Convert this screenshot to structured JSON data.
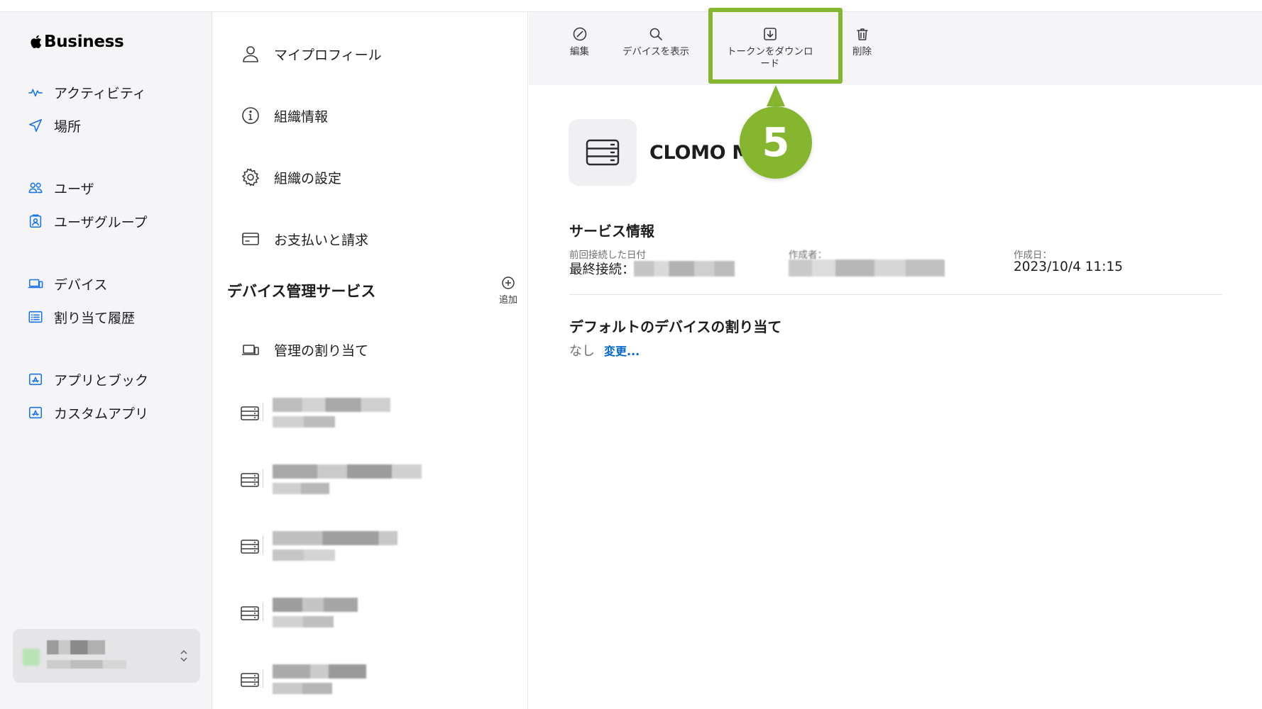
{
  "brand": {
    "name": "Business"
  },
  "sidebar": {
    "items": [
      {
        "label": "アクティビティ",
        "icon": "activity-icon"
      },
      {
        "label": "場所",
        "icon": "location-arrow-icon"
      },
      {
        "label": "ユーザ",
        "icon": "users-icon"
      },
      {
        "label": "ユーザグループ",
        "icon": "user-group-icon"
      },
      {
        "label": "デバイス",
        "icon": "devices-icon"
      },
      {
        "label": "割り当て履歴",
        "icon": "assignment-history-icon"
      },
      {
        "label": "アプリとブック",
        "icon": "app-store-icon"
      },
      {
        "label": "カスタムアプリ",
        "icon": "custom-app-icon"
      }
    ]
  },
  "settings_menu": {
    "items": [
      {
        "label": "マイプロフィール",
        "icon": "person-icon"
      },
      {
        "label": "組織情報",
        "icon": "info-icon"
      },
      {
        "label": "組織の設定",
        "icon": "gear-icon"
      },
      {
        "label": "お支払いと請求",
        "icon": "credit-card-icon"
      }
    ],
    "device_services": {
      "title": "デバイス管理サービス",
      "add_label": "追加",
      "assignment_label": "管理の割り当て"
    }
  },
  "toolbar": {
    "edit_label": "編集",
    "show_devices_label": "デバイスを表示",
    "download_token_label_line1": "トークンをダウンロ",
    "download_token_label_line2": "ード",
    "delete_label": "削除"
  },
  "callout": {
    "number": "5",
    "color": "#86b52f"
  },
  "detail": {
    "service_name": "CLOMO M",
    "service_info_title": "サービス情報",
    "last_connected_label": "前回接続した日付",
    "last_connected_prefix": "最終接続：",
    "created_by_label": "作成者：",
    "created_date_label": "作成日：",
    "created_date_value": "2023/10/4 11:15",
    "default_assignment_title": "デフォルトのデバイスの割り当て",
    "default_assignment_value": "なし",
    "change_link": "変更..."
  },
  "colors": {
    "accent": "#1a73e8",
    "link": "#0066cc",
    "highlight": "#86b52f"
  }
}
